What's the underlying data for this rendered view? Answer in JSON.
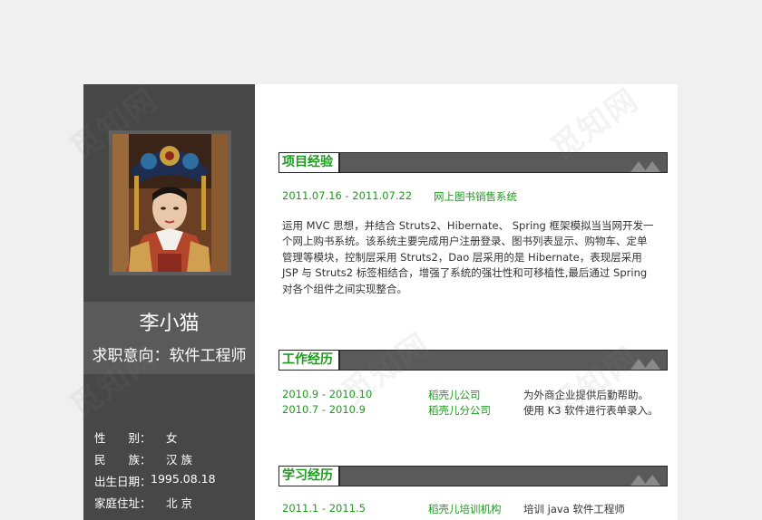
{
  "watermark": "觅知网",
  "profile": {
    "name": "李小猫",
    "job_intent": "求职意向：软件工程师",
    "info": [
      {
        "label": "性　　别：",
        "value": "女"
      },
      {
        "label": "民　　族：",
        "value": "汉 族"
      },
      {
        "label": "出生日期：",
        "value": "1995.08.18"
      },
      {
        "label": "家庭住址：",
        "value": "北 京"
      }
    ]
  },
  "sections": {
    "project": {
      "title": "项目经验",
      "period": "2011.07.16 - 2011.07.22",
      "name": "网上图书销售系统",
      "description": "运用 MVC 思想，并结合 Struts2、Hibernate、 Spring 框架模拟当当网开发一个网上购书系统。该系统主要完成用户注册登录、图书列表显示、购物车、定单管理等模块，控制层采用 Struts2，Dao 层采用的是 Hibernate，表现层采用 JSP 与 Struts2 标签相结合，增强了系统的强壮性和可移植性,最后通过 Spring 对各个组件之间实现整合。"
    },
    "work": {
      "title": "工作经历",
      "rows": [
        {
          "period": "2010.9 - 2010.10",
          "company": "稻壳儿公司",
          "detail": "为外商企业提供后勤帮助。"
        },
        {
          "period": "2010.7 - 2010.9",
          "company": "稻壳儿分公司",
          "detail": "使用 K3 软件进行表单录入。"
        }
      ]
    },
    "education": {
      "title": "学习经历",
      "rows": [
        {
          "period": "2011.1 - 2011.5",
          "school": "稻壳儿培训机构",
          "detail": "培训 java 软件工程师"
        }
      ]
    }
  },
  "colors": {
    "accent": "#1e9a1e",
    "sidebar": "#474747",
    "band": "#5a5a5a"
  }
}
